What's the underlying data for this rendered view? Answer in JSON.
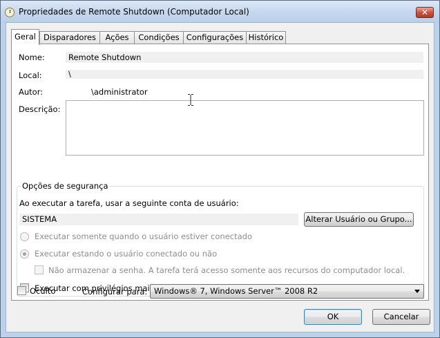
{
  "window": {
    "title": "Propriedades de Remote Shutdown (Computador Local)",
    "close_glyph": "✕"
  },
  "tabs": [
    {
      "label": "Geral",
      "active": true
    },
    {
      "label": "Disparadores"
    },
    {
      "label": "Ações"
    },
    {
      "label": "Condições"
    },
    {
      "label": "Configurações"
    },
    {
      "label": "Histórico"
    }
  ],
  "general": {
    "name_label": "Nome:",
    "name_value": "Remote Shutdown",
    "location_label": "Local:",
    "location_value": "\\",
    "author_label": "Autor:",
    "author_value": "\\administrator",
    "description_label": "Descrição:",
    "description_value": ""
  },
  "security": {
    "group_title": "Opções de segurança",
    "run_as_prompt": "Ao executar a tarefa, usar a seguinte conta de usuário:",
    "user_account": "SISTEMA",
    "change_user_button": "Alterar Usuário ou Grupo...",
    "radio_logged_on_only": "Executar somente quando o usuário estiver conectado",
    "radio_logged_on_or_not": "Executar estando o usuário conectado ou não",
    "no_store_password": "Não armazenar a senha. A tarefa terá acesso somente aos recursos do computador local.",
    "highest_privileges": "Executar com privilégios mais altos"
  },
  "footer": {
    "hidden_label": "Oculto",
    "configure_for_label": "Configurar para:",
    "configure_for_value": "Windows® 7, Windows Server™ 2008 R2",
    "ok_button": "OK",
    "cancel_button": "Cancelar"
  },
  "icons": {
    "app": "clock-task-icon",
    "close": "close-icon",
    "dropdown": "chevron-down-icon"
  }
}
